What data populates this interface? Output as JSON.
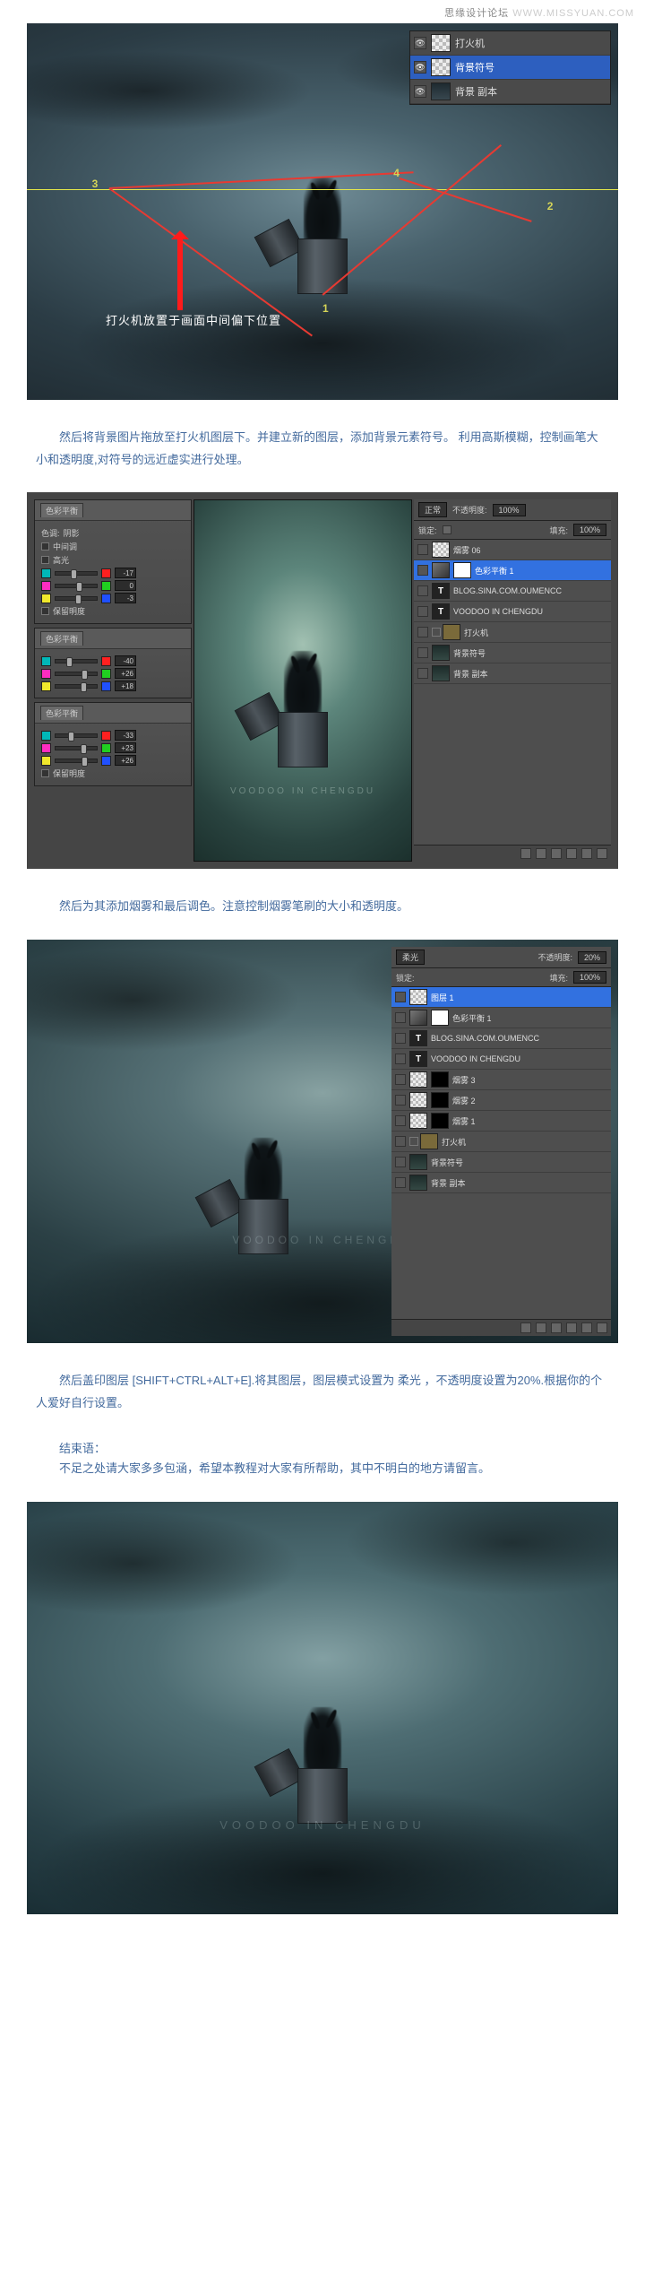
{
  "watermark": {
    "zh": "思缘设计论坛",
    "url": "WWW.MISSYUAN.COM"
  },
  "figure_watermark": "VOODOO IN CHENGDU",
  "img1": {
    "caption": "打火机放置于画面中间偏下位置",
    "guide_numbers": {
      "n1": "1",
      "n2": "2",
      "n3": "3",
      "n4": "4"
    },
    "layers": {
      "r1": "打火机",
      "r2": "背景符号",
      "r3": "背景 副本"
    }
  },
  "para1": "然后将背景图片拖放至打火机图层下。并建立新的图层，添加背景元素符号。 利用高斯模糊，控制画笔大小和透明度,对符号的远近虚实进行处理。",
  "img2": {
    "panel_color_balance": {
      "title": "色彩平衡",
      "tone_label": "色调:",
      "tone_shadow": "阴影",
      "tone_mid": "中间调",
      "tone_high": "高光",
      "cy_rd": "青色 / 红色",
      "mg_gn": "洋红 / 绿色",
      "yl_bl": "黄色 / 蓝色",
      "preserve": "保留明度",
      "v1": "-17",
      "v2": "0",
      "v3": "-3",
      "v4": "-40",
      "v5": "+26",
      "v6": "+18",
      "v7": "-33",
      "v8": "+23",
      "v9": "+26"
    },
    "layer_panel": {
      "blend": "正常",
      "opacity_lbl": "不透明度:",
      "opacity": "100%",
      "lock_lbl": "锁定:",
      "fill_lbl": "填充:",
      "fill": "100%",
      "items": [
        {
          "name": "烟雾 06",
          "type": "img"
        },
        {
          "name": "色彩平衡 1",
          "type": "adj",
          "sel": true
        },
        {
          "name": "BLOG.SINA.COM.OUMENCC",
          "type": "text"
        },
        {
          "name": "VOODOO IN CHENGDU",
          "type": "text"
        },
        {
          "name": "打火机",
          "type": "group"
        },
        {
          "name": "背景符号",
          "type": "img"
        },
        {
          "name": "背景 副本",
          "type": "img"
        }
      ]
    }
  },
  "para2": "然后为其添加烟雾和最后调色。注意控制烟雾笔刷的大小和透明度。",
  "img3": {
    "layer_panel": {
      "blend": "柔光",
      "opacity_lbl": "不透明度:",
      "opacity": "20%",
      "lock_lbl": "锁定:",
      "fill_lbl": "填充:",
      "fill": "100%",
      "items": [
        {
          "name": "图层 1",
          "type": "img",
          "sel": true
        },
        {
          "name": "色彩平衡 1",
          "type": "adj"
        },
        {
          "name": "BLOG.SINA.COM.OUMENCC",
          "type": "text"
        },
        {
          "name": "VOODOO IN CHENGDU",
          "type": "text"
        },
        {
          "name": "烟雾 3",
          "type": "img"
        },
        {
          "name": "烟雾 2",
          "type": "img"
        },
        {
          "name": "烟雾 1",
          "type": "img"
        },
        {
          "name": "打火机",
          "type": "group"
        },
        {
          "name": "背景符号",
          "type": "img"
        },
        {
          "name": "背景 副本",
          "type": "img"
        }
      ]
    }
  },
  "para3": "然后盖印图层 [SHIFT+CTRL+ALT+E].将其图层，图层模式设置为 柔光 ，不透明度设置为20%.根据你的个人爱好自行设置。",
  "closing": {
    "label": "结束语：",
    "text": "不足之处请大家多多包涵，希望本教程对大家有所帮助，其中不明白的地方请留言。"
  }
}
